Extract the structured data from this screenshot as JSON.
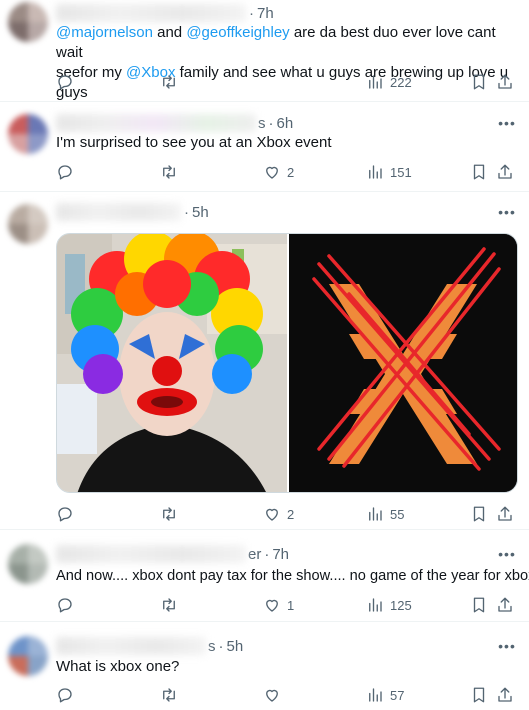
{
  "tweets": [
    {
      "time": "7h",
      "name_tail": "",
      "mention1": "@majornelson",
      "and_text": " and ",
      "mention2": "@geoffkeighley",
      "text1": " are da best duo ever love  cant wait",
      "text2_pre": "seefor my ",
      "mention3": "@Xbox",
      "text2_post": "  family and see what u guys are brewing up love u guys",
      "replies": "",
      "retweets": "",
      "likes": "",
      "views": "222"
    },
    {
      "time": "6h",
      "name_tail": "s",
      "text": "I'm surprised to see you at an Xbox event",
      "replies": "",
      "retweets": "",
      "likes": "2",
      "views": "151"
    },
    {
      "time": "5h",
      "name_tail": "",
      "text": "",
      "replies": "",
      "retweets": "",
      "likes": "2",
      "views": "55"
    },
    {
      "time": "7h",
      "name_tail": "er",
      "text": "And now.... xbox dont pay tax for the  show.... no game of the year for xbox",
      "replies": "",
      "retweets": "",
      "likes": "1",
      "views": "125"
    },
    {
      "time": "5h",
      "name_tail": "s",
      "text": "What is xbox one?",
      "replies": "",
      "retweets": "",
      "likes": "",
      "views": "57"
    }
  ],
  "ui": {
    "dot": "·",
    "more": "•••"
  },
  "icons": {
    "reply": "reply-icon",
    "retweet": "retweet-icon",
    "like": "heart-icon",
    "views": "views-icon",
    "bookmark": "bookmark-icon",
    "share": "share-icon"
  },
  "colors": {
    "link": "#1d9bf0",
    "muted": "#536471",
    "text": "#0f1419",
    "divider": "#eff3f4"
  }
}
